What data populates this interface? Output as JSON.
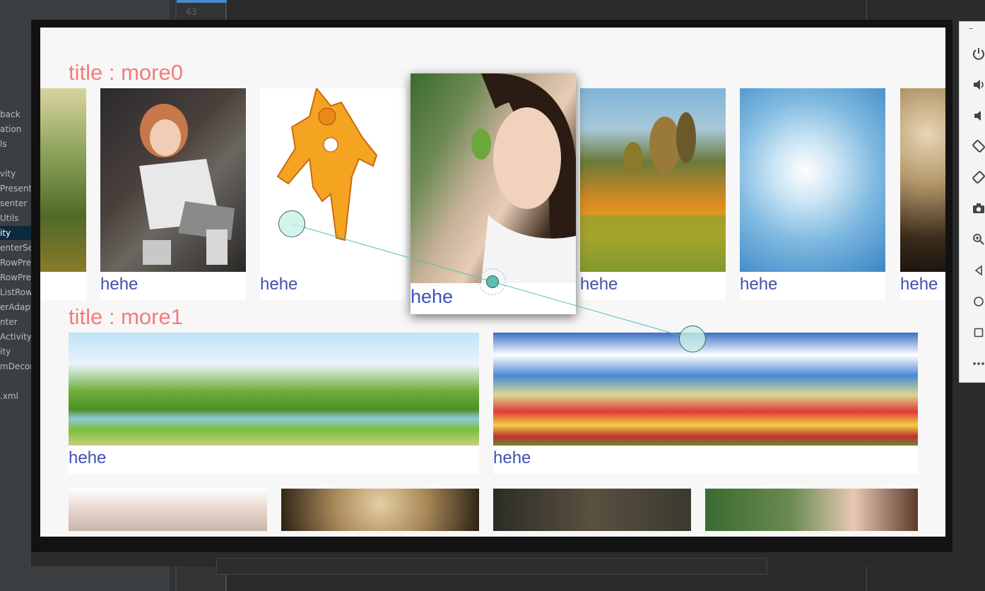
{
  "ide": {
    "line_number": "63",
    "tree_items": [
      "back",
      "ation",
      "ls",
      "",
      "vity",
      "Presente",
      "senter",
      "Utils",
      "ity",
      "enterSel",
      "RowPre",
      "RowPre",
      "ListRow",
      "erAdapt",
      "nter",
      "Activity",
      "ity",
      "mDecor",
      "",
      ".xml"
    ],
    "selected_index": 8
  },
  "screen": {
    "rows": [
      {
        "title": "title : more0",
        "cards": [
          {
            "caption": "",
            "image": "forest"
          },
          {
            "caption": "hehe",
            "image": "girl-dark"
          },
          {
            "caption": "hehe",
            "image": "cartoon"
          },
          {
            "caption": "hehe",
            "image": "girl-green",
            "focused": true
          },
          {
            "caption": "hehe",
            "image": "field"
          },
          {
            "caption": "hehe",
            "image": "swirl"
          },
          {
            "caption": "hehe",
            "image": "bokeh"
          }
        ]
      },
      {
        "title": "title : more1",
        "cards": [
          {
            "caption": "hehe",
            "image": "lake"
          },
          {
            "caption": "hehe",
            "image": "flowers"
          }
        ]
      },
      {
        "title": "",
        "cards": [
          {
            "caption": "",
            "image": "lace"
          },
          {
            "caption": "",
            "image": "bokeh2"
          },
          {
            "caption": "",
            "image": "dark"
          },
          {
            "caption": "",
            "image": "girl2"
          }
        ]
      }
    ]
  },
  "emulator_controls": [
    {
      "icon": "power-icon"
    },
    {
      "icon": "volume-up-icon"
    },
    {
      "icon": "volume-down-icon"
    },
    {
      "icon": "rotate-left-icon"
    },
    {
      "icon": "rotate-right-icon"
    },
    {
      "icon": "camera-icon"
    },
    {
      "icon": "zoom-icon"
    },
    {
      "icon": "back-icon"
    },
    {
      "icon": "home-icon"
    },
    {
      "icon": "overview-icon"
    },
    {
      "icon": "more-icon"
    }
  ],
  "colors": {
    "title": "#f47c7c",
    "caption": "#3f51b5",
    "pointer": "#5bbfae"
  }
}
